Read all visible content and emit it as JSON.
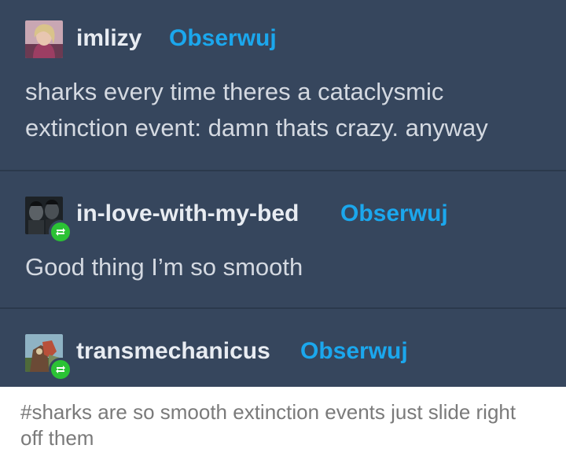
{
  "thread": {
    "background": "#36465d",
    "follow_color": "#1ba7ed",
    "reblog_badge_color": "#2bc235",
    "posts": [
      {
        "username": "imlizy",
        "follow_label": "Obserwuj",
        "reblog": false,
        "avatar_icon": "avatar-photo",
        "text": "sharks every time theres a cataclysmic extinction event: damn thats crazy. anyway"
      },
      {
        "username": "in-love-with-my-bed",
        "follow_label": "Obserwuj",
        "reblog": true,
        "avatar_icon": "avatar-photo",
        "text": "Good thing I’m so smooth"
      },
      {
        "username": "transmechanicus",
        "follow_label": "Obserwuj",
        "reblog": true,
        "avatar_icon": "avatar-photo",
        "text": ""
      }
    ]
  },
  "tags": {
    "text": "#sharks are so smooth extinction events just slide right off them"
  }
}
